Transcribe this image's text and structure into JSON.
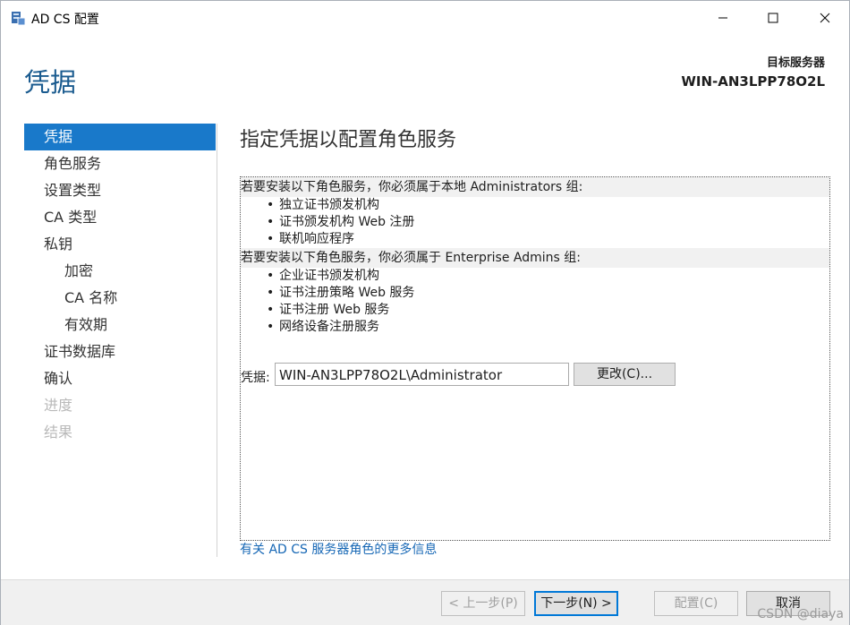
{
  "window": {
    "title": "AD CS 配置",
    "controls": {
      "minimize": "minimize-icon",
      "maximize": "maximize-icon",
      "close": "close-icon"
    }
  },
  "header": {
    "page_title": "凭据",
    "target_label": "目标服务器",
    "target_server": "WIN-AN3LPP78O2L"
  },
  "nav": {
    "items": [
      {
        "label": "凭据",
        "state": "active"
      },
      {
        "label": "角色服务",
        "state": "normal"
      },
      {
        "label": "设置类型",
        "state": "normal"
      },
      {
        "label": "CA 类型",
        "state": "normal"
      },
      {
        "label": "私钥",
        "state": "normal"
      },
      {
        "label": "加密",
        "state": "sub"
      },
      {
        "label": "CA 名称",
        "state": "sub"
      },
      {
        "label": "有效期",
        "state": "sub"
      },
      {
        "label": "证书数据库",
        "state": "normal"
      },
      {
        "label": "确认",
        "state": "normal"
      },
      {
        "label": "进度",
        "state": "disabled"
      },
      {
        "label": "结果",
        "state": "disabled"
      }
    ]
  },
  "main": {
    "title": "指定凭据以配置角色服务",
    "local_admins_text": "若要安装以下角色服务，你必须属于本地 Administrators 组:",
    "local_admins_services": [
      "独立证书颁发机构",
      "证书颁发机构 Web 注册",
      "联机响应程序"
    ],
    "enterprise_admins_text": "若要安装以下角色服务，你必须属于 Enterprise Admins 组:",
    "enterprise_admins_services": [
      "企业证书颁发机构",
      "证书注册策略 Web 服务",
      "证书注册 Web 服务",
      "网络设备注册服务"
    ],
    "credentials_label": "凭据:",
    "credentials_value": "WIN-AN3LPP78O2L\\Administrator",
    "change_button": "更改(C)...",
    "more_info_link": "有关 AD CS 服务器角色的更多信息"
  },
  "footer": {
    "prev": "< 上一步(P)",
    "next": "下一步(N) >",
    "configure": "配置(C)",
    "cancel": "取消"
  },
  "watermark": "CSDN @diaya",
  "colors": {
    "accent": "#1979ca",
    "heading": "#1a5b8f",
    "link": "#1667b5"
  }
}
